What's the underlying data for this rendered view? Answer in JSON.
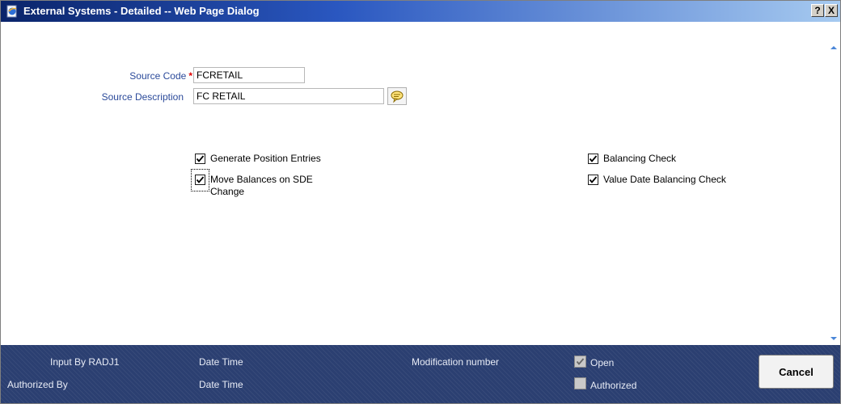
{
  "window": {
    "title": "External Systems - Detailed -- Web Page Dialog",
    "help_label": "?",
    "close_label": "X"
  },
  "form": {
    "source_code": {
      "label": "Source Code",
      "required_mark": "*",
      "value": "FCRETAIL"
    },
    "source_description": {
      "label": "Source Description",
      "value": "FC RETAIL"
    }
  },
  "checkboxes": {
    "generate_position_entries": {
      "label": "Generate Position Entries",
      "checked": true
    },
    "move_balances": {
      "label": "Move Balances on SDE Change",
      "checked": true
    },
    "balancing_check": {
      "label": "Balancing Check",
      "checked": true
    },
    "value_date_balancing_check": {
      "label": "Value Date Balancing Check",
      "checked": true
    }
  },
  "footer": {
    "input_by": "Input By RADJ1",
    "authorized_by": "Authorized By",
    "date_time_1": "Date Time",
    "date_time_2": "Date Time",
    "modification_number": "Modification number",
    "open": {
      "label": "Open",
      "checked": true
    },
    "authorized": {
      "label": "Authorized",
      "checked": false
    },
    "cancel_label": "Cancel"
  },
  "colors": {
    "label_blue": "#2b4a9a",
    "footer_bg": "#2b3f71",
    "required_red": "#e00000"
  },
  "icons": {
    "window": "ie-page-icon",
    "lov": "speech-bubble-icon"
  }
}
